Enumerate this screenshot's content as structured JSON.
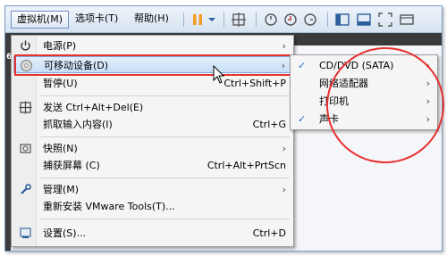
{
  "toolbar": {
    "menus": [
      "虚拟机(M)",
      "选项卡(T)",
      "帮助(H)"
    ]
  },
  "console": {
    "left_char": "6"
  },
  "menu": {
    "items": [
      {
        "label": "电源(P)",
        "shortcut": "",
        "submenu": true,
        "icon": "power-icon"
      },
      {
        "label": "可移动设备(D)",
        "shortcut": "",
        "submenu": true,
        "icon": "cd-disc-icon"
      },
      {
        "label": "暂停(U)",
        "shortcut": "Ctrl+Shift+P",
        "submenu": false,
        "icon": ""
      },
      {
        "label": "发送 Ctrl+Alt+Del(E)",
        "shortcut": "",
        "submenu": false,
        "icon": "keyboard-icon"
      },
      {
        "label": "抓取输入内容(I)",
        "shortcut": "Ctrl+G",
        "submenu": false,
        "icon": ""
      },
      {
        "label": "快照(N)",
        "shortcut": "",
        "submenu": true,
        "icon": "snapshot-icon"
      },
      {
        "label": "捕获屏幕 (C)",
        "shortcut": "Ctrl+Alt+PrtScn",
        "submenu": false,
        "icon": ""
      },
      {
        "label": "管理(M)",
        "shortcut": "",
        "submenu": true,
        "icon": "wrench-icon"
      },
      {
        "label": "重新安装 VMware Tools(T)...",
        "shortcut": "",
        "submenu": false,
        "icon": ""
      },
      {
        "label": "设置(S)...",
        "shortcut": "Ctrl+D",
        "submenu": false,
        "icon": "settings-icon"
      }
    ]
  },
  "submenu": {
    "items": [
      {
        "label": "CD/DVD (SATA)",
        "checked": true
      },
      {
        "label": "网络适配器",
        "checked": false
      },
      {
        "label": "打印机",
        "checked": false
      },
      {
        "label": "声卡",
        "checked": true
      }
    ]
  },
  "glyphs": {
    "arrow": "›",
    "check": "✓"
  },
  "colors": {
    "highlight_red": "#e8302f",
    "check_blue": "#2a6fc9"
  }
}
